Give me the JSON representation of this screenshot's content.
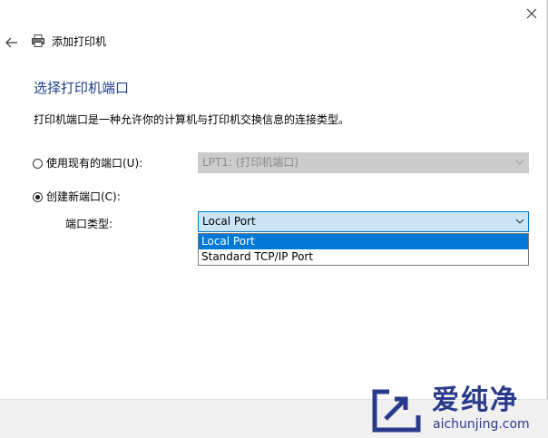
{
  "header": {
    "title": "添加打印机"
  },
  "page": {
    "title": "选择打印机端口",
    "description": "打印机端口是一种允许你的计算机与打印机交换信息的连接类型。"
  },
  "existing_port": {
    "label": "使用现有的端口(U):",
    "selected": false,
    "value": "LPT1: (打印机端口)",
    "enabled": false
  },
  "new_port": {
    "label": "创建新端口(C):",
    "selected": true,
    "type_label": "端口类型:",
    "value": "Local Port",
    "options": [
      "Local Port",
      "Standard TCP/IP Port"
    ],
    "expanded": true
  },
  "watermark": {
    "name": "爱纯净",
    "url": "aichunjing.com"
  },
  "colors": {
    "accent": "#0078d7",
    "title": "#1e3f8b",
    "select_bg": "#cce4f7",
    "disabled_bg": "#cccccc",
    "watermark": "#2a3a8a"
  },
  "icons": {
    "close": "close-icon",
    "back": "back-arrow-icon",
    "printer": "printer-icon",
    "chevron": "chevron-down-icon"
  }
}
